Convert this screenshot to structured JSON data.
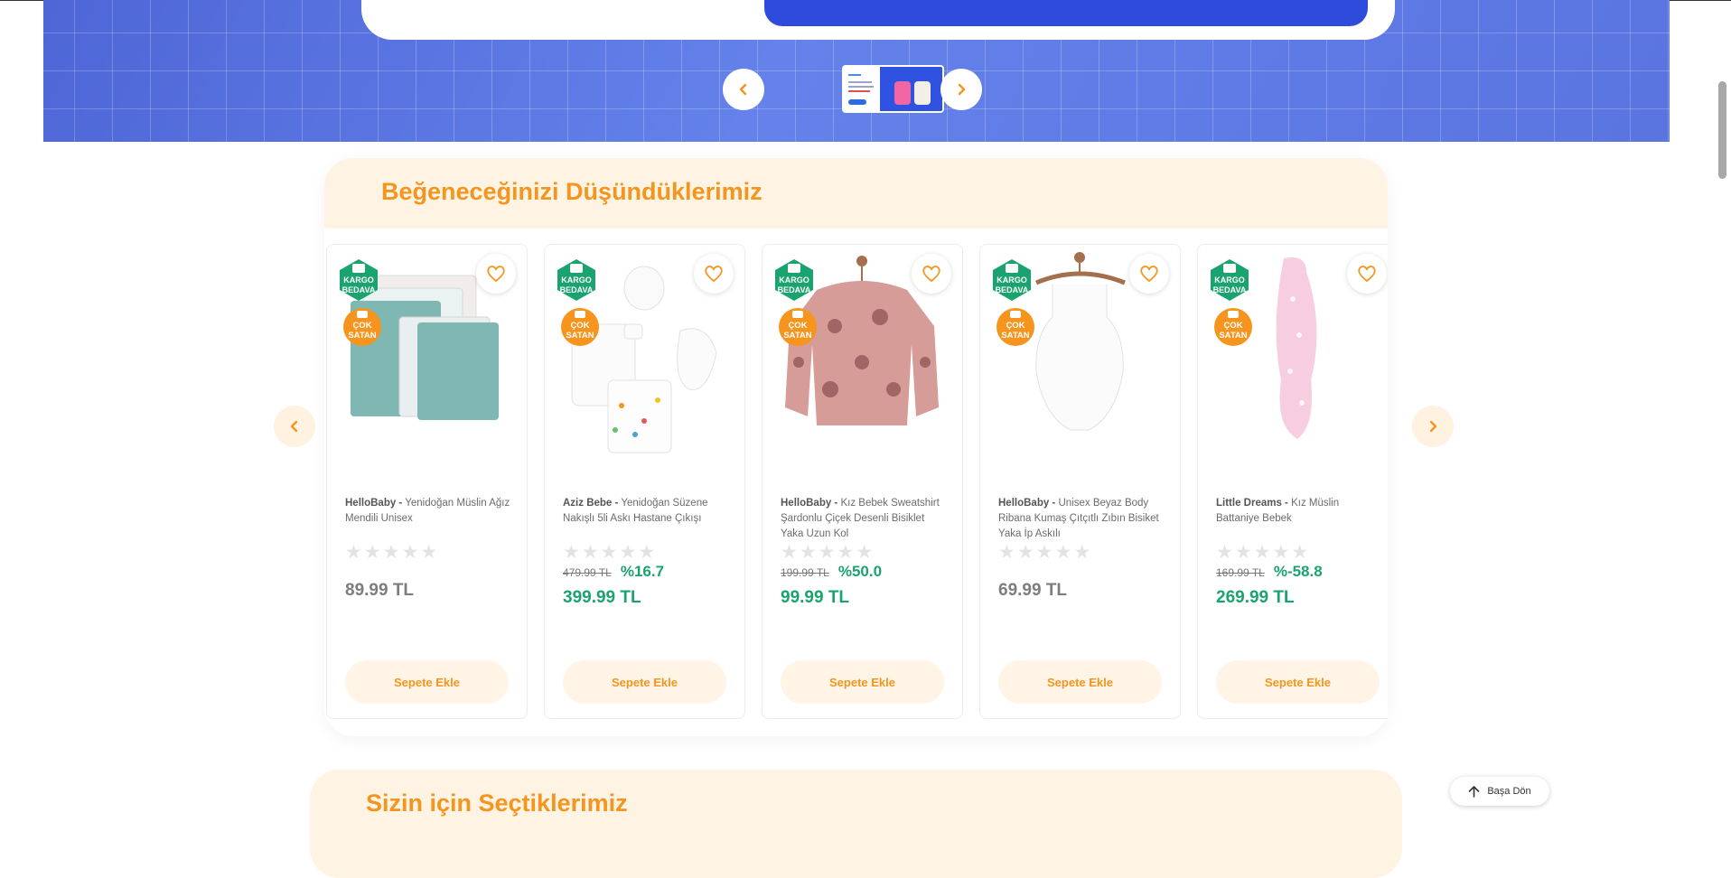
{
  "hero": {
    "prev_icon": "chevron-left-icon",
    "next_icon": "chevron-right-icon",
    "accent_color": "#f3951f",
    "background_color": "#5a74e0"
  },
  "section": {
    "title": "Beğeneceğinizi Düşündüklerimiz",
    "prev_icon": "chevron-left-icon",
    "next_icon": "chevron-right-icon"
  },
  "badges": {
    "kargo_line1": "KARGO",
    "kargo_line2": "BEDAVA",
    "cok_line1": "ÇOK",
    "cok_line2": "SATAN"
  },
  "products": [
    {
      "brand": "HelloBaby -",
      "name": "Yenidoğan Müslin Ağız Mendili Unisex",
      "old_price": "",
      "discount": "",
      "price": "89.99 TL",
      "button": "Sepete Ekle"
    },
    {
      "brand": "Aziz Bebe -",
      "name": "Yenidoğan Süzene Nakışlı 5li Askı Hastane Çıkışı",
      "old_price": "479.99 TL",
      "discount": "%16.7",
      "price": "399.99 TL",
      "button": "Sepete Ekle"
    },
    {
      "brand": "HelloBaby -",
      "name": "Kız Bebek Sweatshirt Şardonlu Çiçek Desenli Bisiklet Yaka Uzun Kol",
      "old_price": "199.99 TL",
      "discount": "%50.0",
      "price": "99.99 TL",
      "button": "Sepete Ekle"
    },
    {
      "brand": "HelloBaby -",
      "name": "Unisex Beyaz Body Ribana Kumaş Çıtçıtlı Zıbın Bisiket Yaka İp Askılı",
      "old_price": "",
      "discount": "",
      "price": "69.99 TL",
      "button": "Sepete Ekle"
    },
    {
      "brand": "Little Dreams -",
      "name": "Kız Müslin Battaniye Bebek",
      "old_price": "169.99 TL",
      "discount": "%-58.8",
      "price": "269.99 TL",
      "button": "Sepete Ekle"
    }
  ],
  "section2": {
    "title": "Sizin için Seçtiklerimiz"
  },
  "back_to_top": {
    "label": "Başa Dön",
    "icon": "arrow-up-icon"
  },
  "colors": {
    "accent": "#f3951f",
    "sale_green": "#1aa36f",
    "badge_green": "#1aa36f",
    "badge_orange": "#f7941d"
  }
}
